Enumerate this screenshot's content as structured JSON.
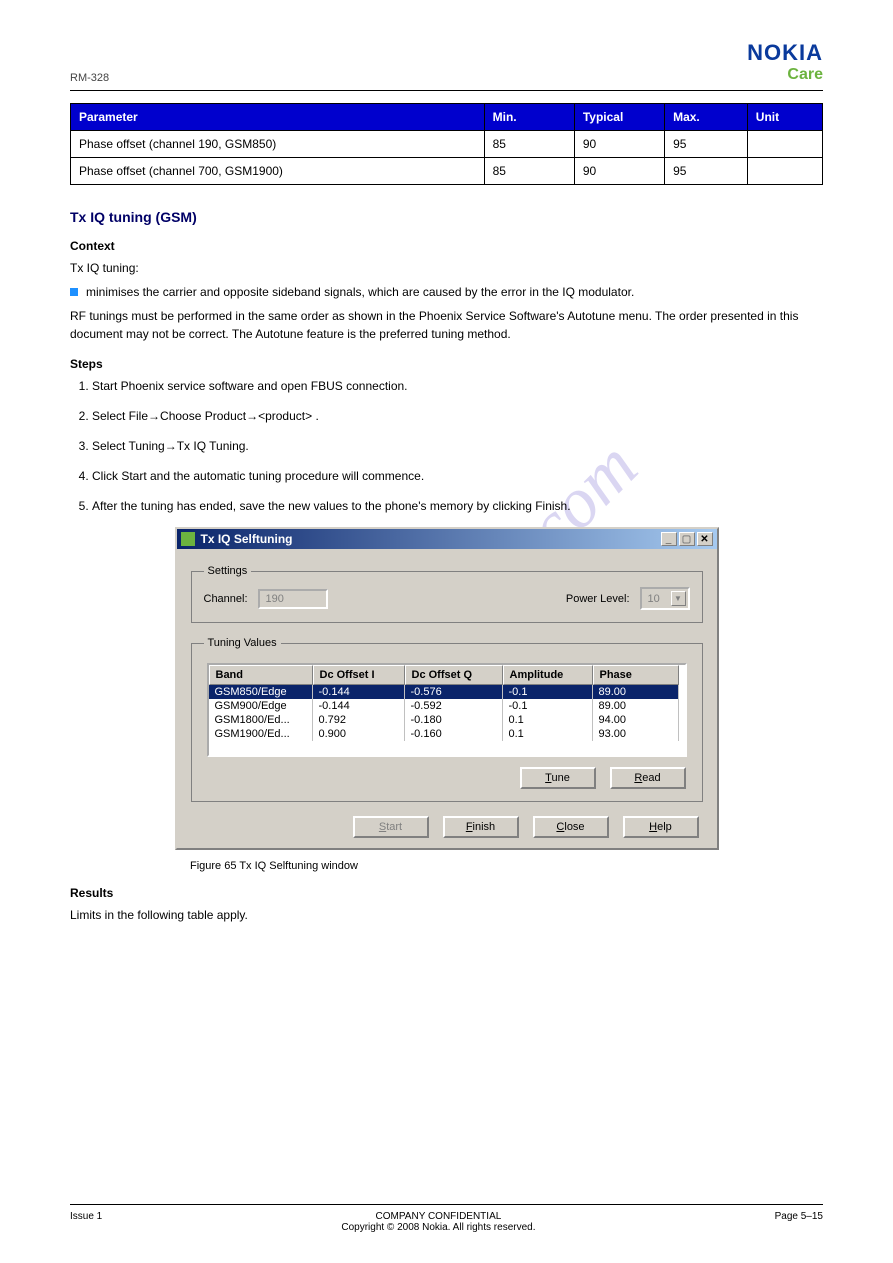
{
  "watermark": "manualshive.com",
  "header": {
    "left": "RM-328",
    "logo_main": "NOKIA",
    "logo_sub": "Care"
  },
  "outer_table": {
    "columns": [
      "Parameter",
      "Min.",
      "Typical",
      "Max.",
      "Unit"
    ],
    "rows": [
      [
        "Phase offset (channel 190, GSM850)",
        "85",
        "90",
        "95",
        ""
      ],
      [
        "Phase offset (channel 700, GSM1900)",
        "85",
        "90",
        "95",
        ""
      ]
    ]
  },
  "section_title": "Tx IQ tuning (GSM)",
  "context_heading": "Context",
  "context_line": "Tx IQ tuning:",
  "context_bullet": "minimises the carrier and opposite sideband signals, which are caused by the error in the IQ modulator.",
  "context_para": "RF tunings must be performed in the same order as shown in the Phoenix Service Software's Autotune menu. The order presented in this document may not be correct. The Autotune feature is the preferred tuning method.",
  "steps_count": "Steps",
  "steps": [
    "Start Phoenix service software and open FBUS connection.",
    "Select File→Choose Product→<product> .",
    "Select Tuning→Tx IQ Tuning.",
    "Click Start and the automatic tuning procedure will commence.",
    "After the tuning has ended, save the new values to the phone's memory by clicking Finish."
  ],
  "dialog": {
    "title": "Tx IQ Selftuning",
    "settings_group": "Settings",
    "channel_label": "Channel:",
    "channel_value": "190",
    "powerlevel_label": "Power Level:",
    "powerlevel_value": "10",
    "tuning_group": "Tuning Values",
    "columns": [
      "Band",
      "Dc Offset I",
      "Dc Offset Q",
      "Amplitude",
      "Phase"
    ],
    "rows": [
      {
        "band": "GSM850/Edge",
        "i": "-0.144",
        "q": "-0.576",
        "a": "-0.1",
        "p": "89.00",
        "selected": true
      },
      {
        "band": "GSM900/Edge",
        "i": "-0.144",
        "q": "-0.592",
        "a": "-0.1",
        "p": "89.00",
        "selected": false
      },
      {
        "band": "GSM1800/Ed...",
        "i": "0.792",
        "q": "-0.180",
        "a": "0.1",
        "p": "94.00",
        "selected": false
      },
      {
        "band": "GSM1900/Ed...",
        "i": "0.900",
        "q": "-0.160",
        "a": "0.1",
        "p": "93.00",
        "selected": false
      }
    ],
    "btn_tune": "Tune",
    "btn_read": "Read",
    "btn_start": "Start",
    "btn_finish": "Finish",
    "btn_close": "Close",
    "btn_help": "Help"
  },
  "figure_caption": "Figure 65 Tx IQ Selftuning window",
  "results_heading": "Results",
  "results_text": "Limits in the following table apply.",
  "footer": {
    "left": "Issue 1",
    "center_top": "COMPANY CONFIDENTIAL",
    "center_bottom": "Copyright © 2008 Nokia. All rights reserved.",
    "right": "Page 5–15"
  }
}
